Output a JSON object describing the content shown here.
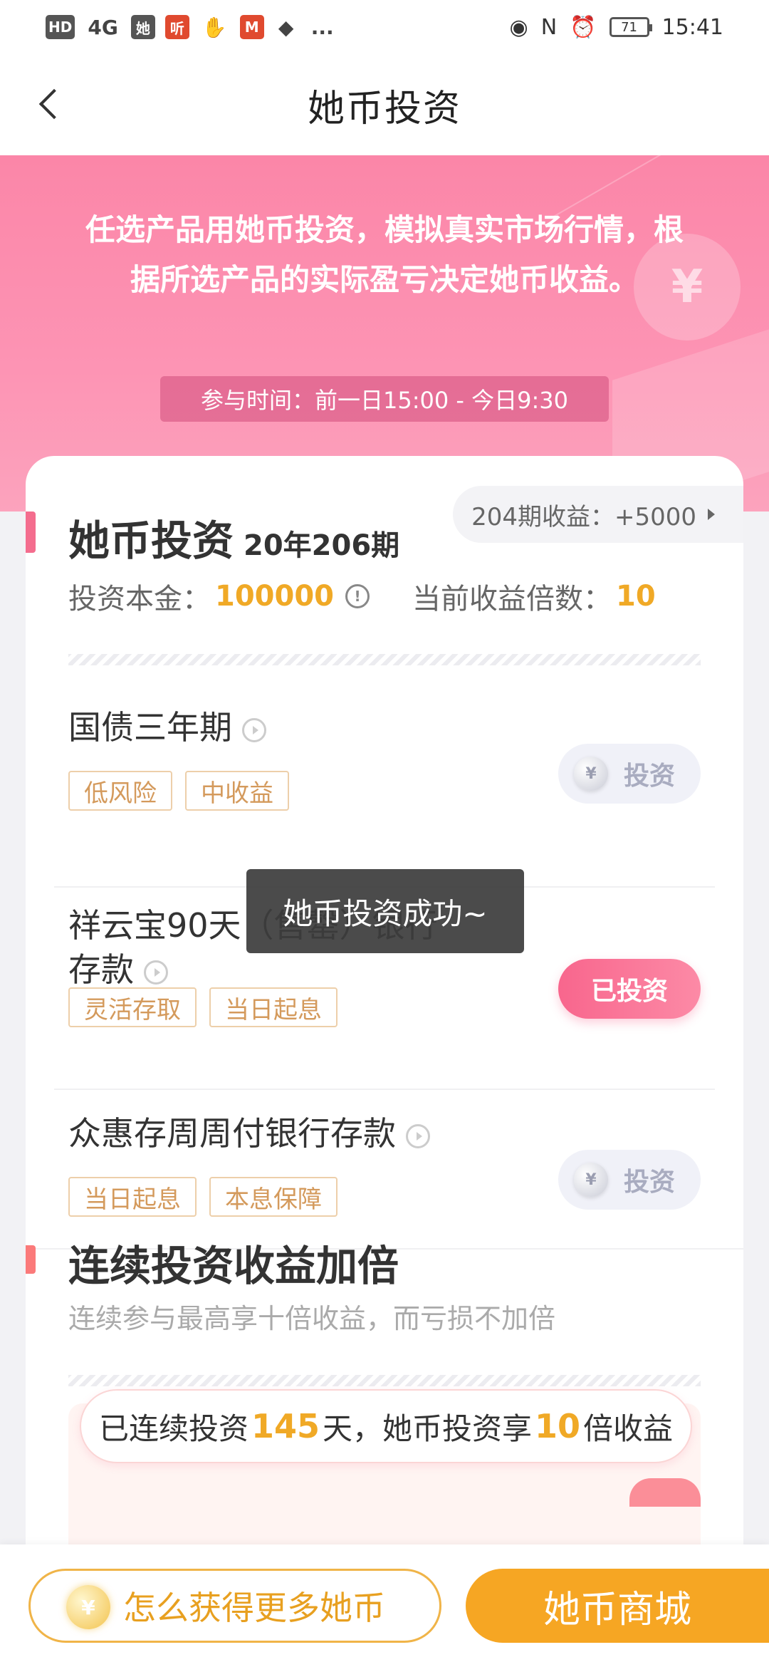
{
  "status_bar": {
    "left_icons": [
      "HD",
      "4G",
      "她",
      "听",
      "✋",
      "M",
      "penguin-icon",
      "..."
    ],
    "battery": "71",
    "time": "15:41"
  },
  "nav": {
    "title": "她币投资"
  },
  "banner": {
    "description": "任选产品用她币投资，模拟真实市场行情，根据所选产品的实际盈亏决定她币收益。",
    "time_range": "参与时间：前一日15:00 - 今日9:30"
  },
  "investment": {
    "title": "她币投资",
    "period": "20年206期",
    "history_label": "204期收益：+5000",
    "principal_label": "投资本金：",
    "principal_value": "100000",
    "multiplier_label": "当前收益倍数：",
    "multiplier_value": "10"
  },
  "products": [
    {
      "name": "国债三年期",
      "tags": [
        "低风险",
        "中收益"
      ],
      "button": "投资",
      "invested": false
    },
    {
      "name_line1": "祥云宝90天（售罄）银行",
      "name_line2": "存款",
      "tags": [
        "灵活存取",
        "当日起息"
      ],
      "button": "已投资",
      "invested": true
    },
    {
      "name": "众惠存周周付银行存款",
      "tags": [
        "当日起息",
        "本息保障"
      ],
      "button": "投资",
      "invested": false
    }
  ],
  "streak_section": {
    "title": "连续投资收益加倍",
    "subtitle": "连续参与最高享十倍收益，而亏损不加倍",
    "text_prefix": "已连续投资",
    "days": "145",
    "text_mid": "天，她币投资享",
    "multiplier": "10",
    "text_suffix": "倍收益"
  },
  "toast": {
    "message": "她币投资成功~"
  },
  "bottom": {
    "earn_button": "怎么获得更多她币",
    "mall_button": "她币商城"
  },
  "coin_symbol": "¥",
  "colors": {
    "pink": "#f46d8e",
    "gold": "#f6a623",
    "value": "#f0a926"
  }
}
